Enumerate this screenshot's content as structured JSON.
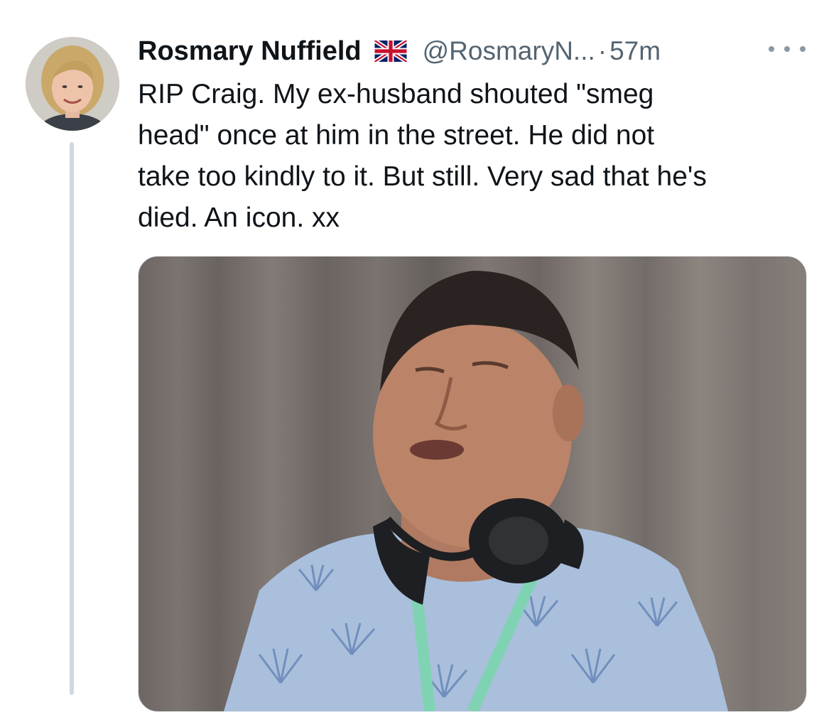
{
  "tweet": {
    "author": {
      "display_name": "Rosmary Nuffield",
      "flag_icon": "uk-flag-icon",
      "handle": "@RosmaryN...",
      "separator": "·",
      "time": "57m"
    },
    "more_icon": "more-options-icon",
    "text": "RIP Craig. My ex-husband shouted \"smeg\nhead\" once at him in the street. He did not\ntake too kindly to it. But still. Very sad that he's\ndied. An icon. xx",
    "media": {
      "kind": "photo"
    }
  },
  "colors": {
    "text": "#0f1419",
    "secondary": "#536471",
    "thread_line": "#cfd9de"
  }
}
